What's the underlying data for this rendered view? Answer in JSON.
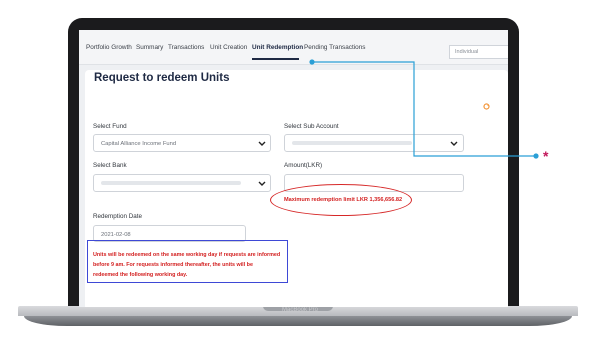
{
  "device": {
    "brand": "MacBook Pro"
  },
  "nav": {
    "tabs": [
      {
        "label": "Portfolio Growth"
      },
      {
        "label": "Summary"
      },
      {
        "label": "Transactions"
      },
      {
        "label": "Unit Creation"
      },
      {
        "label": "Unit Redemption",
        "active": true
      },
      {
        "label": "Pending Transactions"
      }
    ],
    "account_type": "Individual"
  },
  "form": {
    "title": "Request to redeem Units",
    "fund": {
      "label": "Select Fund",
      "value": "Capital Alliance Income Fund"
    },
    "sub_account": {
      "label": "Select Sub Account"
    },
    "bank": {
      "label": "Select Bank"
    },
    "amount": {
      "label": "Amount(LKR)"
    },
    "max_limit": "Maximum redemption limit LKR 1,356,656.82",
    "date": {
      "label": "Redemption Date",
      "value": "2021-02-08"
    },
    "note_lines": [
      "Units will be redeemed on the same working day if requests are informed",
      "before 9 am. For requests informed thereafter, the units will be",
      "redeemed the following working day."
    ]
  },
  "annotation": {
    "marker": "*"
  },
  "colors": {
    "navy": "#1f2a44",
    "warning_red": "#d32020",
    "annotation_red": "#d62828",
    "annotation_blue": "#3e49d6",
    "callout_line": "#2a9fd6",
    "marker": "#c2185b",
    "refresh_orange": "#f28c28"
  },
  "icons": [
    "chevron-down-icon",
    "refresh-icon",
    "callout-dot-icon"
  ]
}
